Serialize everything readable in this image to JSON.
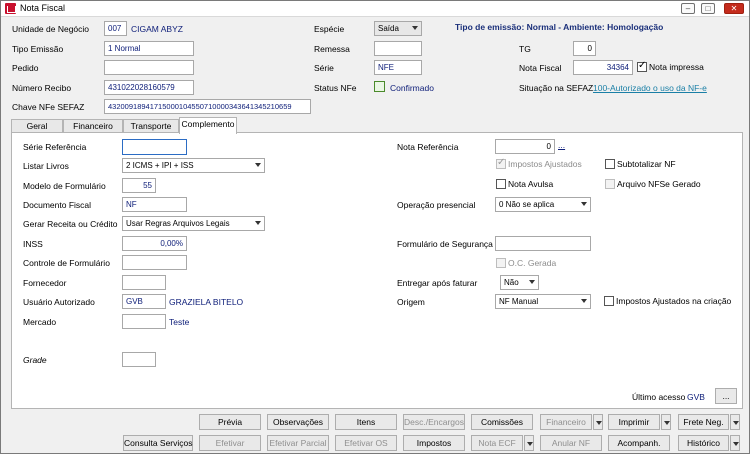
{
  "window": {
    "title": "Nota Fiscal"
  },
  "header": {
    "unidade_label": "Unidade de Negócio",
    "unidade_code": "007",
    "unidade_name": "CIGAM ABYZ",
    "especie_label": "Espécie",
    "especie_value": "Saída",
    "tipo_emissao_info": "Tipo de emissão: Normal - Ambiente: Homologação",
    "tipo_emissao_label": "Tipo Emissão",
    "tipo_emissao_value": "1 Normal",
    "remessa_label": "Remessa",
    "remessa_value": "",
    "tg_label": "TG",
    "tg_value": "0",
    "pedido_label": "Pedido",
    "pedido_value": "",
    "serie_label": "Série",
    "serie_value": "NFE",
    "nota_fiscal_label": "Nota Fiscal",
    "nota_fiscal_value": "34364",
    "nota_impressa_label": "Nota impressa",
    "numero_recibo_label": "Número Recibo",
    "numero_recibo_value": "431022028160579",
    "status_nfe_label": "Status NFe",
    "status_nfe_value": "Confirmado",
    "situacao_label": "Situação na SEFAZ",
    "situacao_value": "100-Autorizado o uso da NF-e",
    "chave_label": "Chave NFe SEFAZ",
    "chave_value": "43200918941715000104550710000343641345210659"
  },
  "tabs": [
    "Geral",
    "Financeiro",
    "Transporte",
    "Complemento"
  ],
  "complemento": {
    "serie_ref_label": "Série Referência",
    "serie_ref_value": "",
    "nota_ref_label": "Nota Referência",
    "nota_ref_value": "0",
    "nota_ref_more": "...",
    "listar_livros_label": "Listar Livros",
    "listar_livros_value": "2 ICMS + IPI + ISS",
    "impostos_ajustados_label": "Impostos Ajustados",
    "subtotalizar_label": "Subtotalizar NF",
    "modelo_label": "Modelo de Formulário",
    "modelo_value": "55",
    "nota_avulsa_label": "Nota Avulsa",
    "arquivo_nfse_label": "Arquivo NFSe Gerado",
    "documento_label": "Documento Fiscal",
    "documento_value": "NF",
    "operacao_label": "Operação presencial",
    "operacao_value": "0 Não se aplica",
    "gerar_receita_label": "Gerar Receita ou Crédito",
    "gerar_receita_value": "Usar Regras Arquivos Legais",
    "inss_label": "INSS",
    "inss_value": "0,00%",
    "form_seguranca_label": "Formulário de Segurança",
    "form_seguranca_value": "",
    "controle_label": "Controle de Formulário",
    "controle_value": "",
    "oc_gerada_label": "O.C. Gerada",
    "fornecedor_label": "Fornecedor",
    "fornecedor_value": "",
    "entregar_label": "Entregar após faturar",
    "entregar_value": "Não",
    "usuario_label": "Usuário Autorizado",
    "usuario_code": "GVB",
    "usuario_name": "GRAZIELA BITELO",
    "origem_label": "Origem",
    "origem_value": "NF Manual",
    "impostos_criacao_label": "Impostos Ajustados na criação",
    "mercado_label": "Mercado",
    "mercado_value": "",
    "mercado_name": "Teste",
    "grade_label": "Grade",
    "grade_value": "",
    "ultimo_acesso_label": "Último acesso",
    "ultimo_acesso_value": "GVB",
    "ultimo_acesso_more": "..."
  },
  "buttons_row1": {
    "previa": "Prévia",
    "observacoes": "Observações",
    "itens": "Itens",
    "desc_encargos": "Desc./Encargos",
    "comissoes": "Comissões",
    "financeiro": "Financeiro",
    "imprimir": "Imprimir",
    "frete_neg": "Frete Neg."
  },
  "buttons_row2": {
    "consulta_servicos": "Consulta Serviços",
    "efetivar": "Efetivar",
    "efetivar_parcial": "Efetivar Parcial",
    "efetivar_os": "Efetivar OS",
    "impostos": "Impostos",
    "nota_ecf": "Nota ECF",
    "anular_nf": "Anular NF",
    "acompanh": "Acompanh.",
    "historico": "Histórico"
  }
}
